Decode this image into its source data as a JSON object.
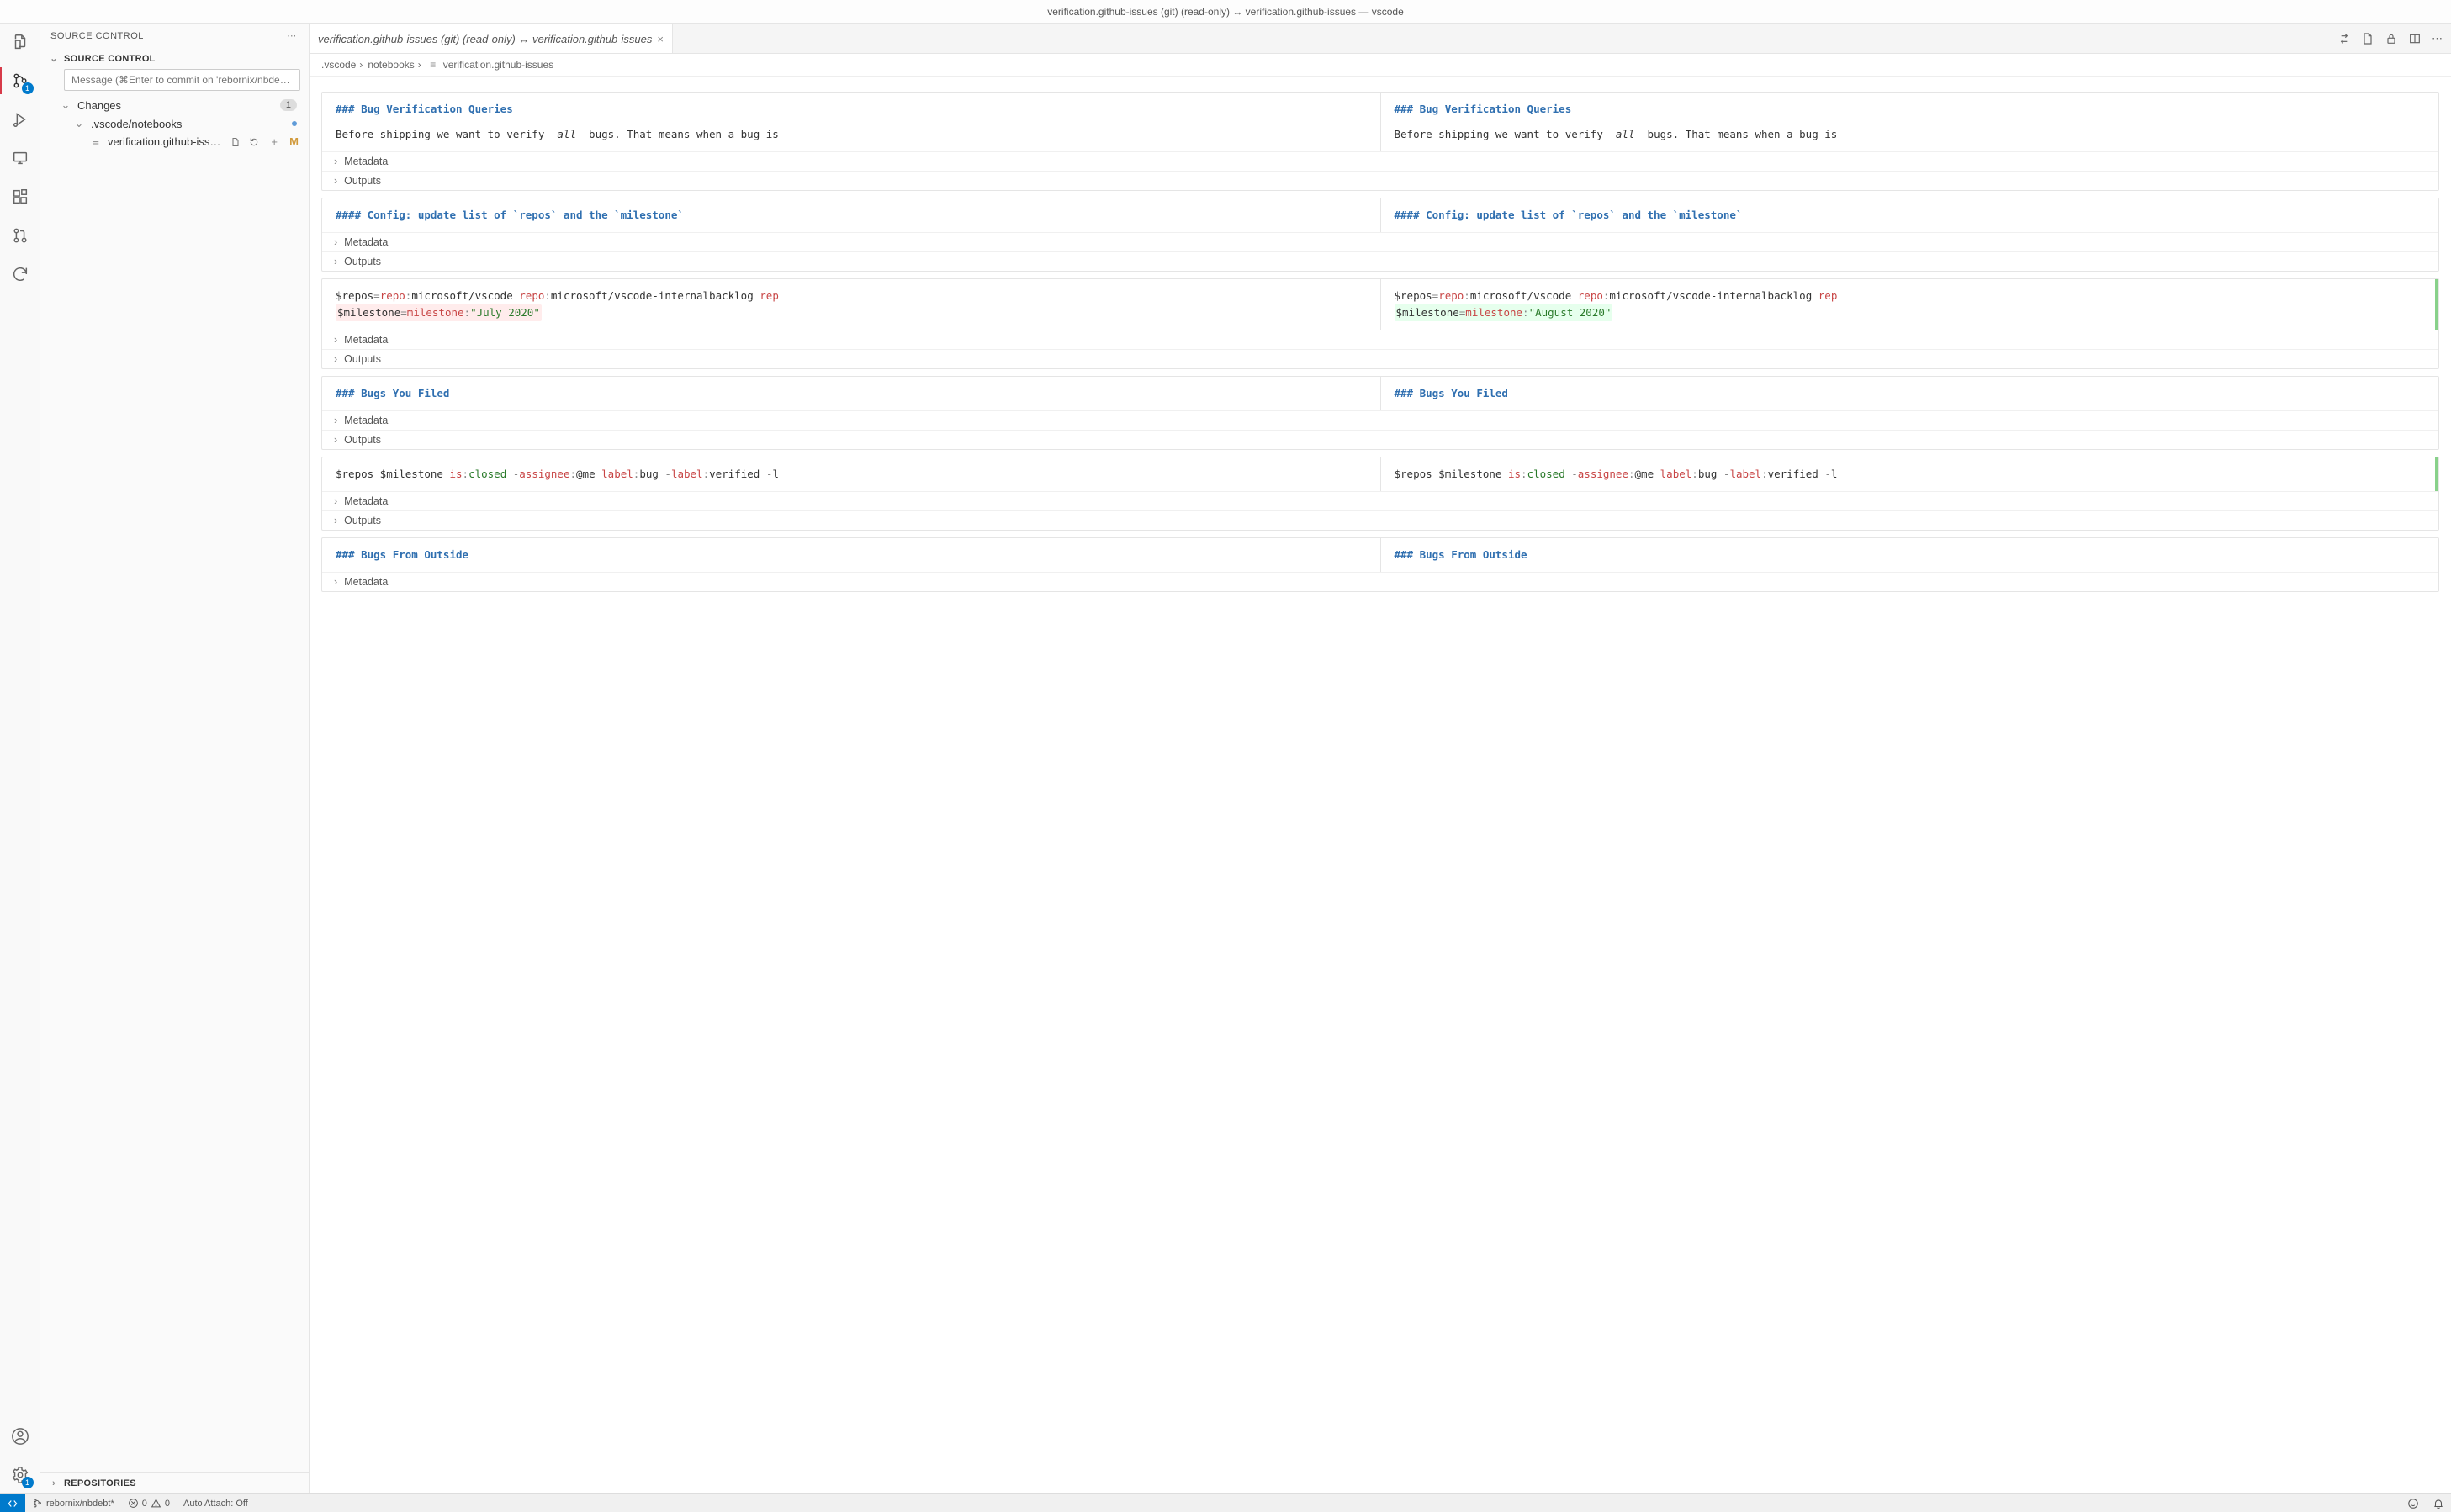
{
  "window": {
    "title": "verification.github-issues (git) (read-only) ↔ verification.github-issues — vscode"
  },
  "activitybar": {
    "scm_badge": "1",
    "settings_badge": "1"
  },
  "sidebar": {
    "title": "SOURCE CONTROL",
    "section": "SOURCE CONTROL",
    "message_placeholder": "Message (⌘Enter to commit on 'rebornix/nbde…",
    "changes_label": "Changes",
    "changes_count": "1",
    "folder": ".vscode/notebooks",
    "file": "verification.github-issues",
    "file_status": "M",
    "repositories": "REPOSITORIES"
  },
  "tab": {
    "label": "verification.github-issues (git) (read-only) ↔ verification.github-issues"
  },
  "breadcrumbs": {
    "a": ".vscode",
    "b": "notebooks",
    "c": "verification.github-issues"
  },
  "labels": {
    "metadata": "Metadata",
    "outputs": "Outputs"
  },
  "cells": {
    "c1": {
      "h": "### Bug Verification Queries",
      "p_pre": "Before shipping we want to verify ",
      "p_em": "_all_",
      "p_post": " bugs. That means when a bug is"
    },
    "c2": {
      "h": "#### Config: update list of `repos` and the `milestone`"
    },
    "c3": {
      "line1": {
        "var": "$repos",
        "eq": "=",
        "k1": "repo",
        "c1": ":",
        "v1": "microsoft/vscode ",
        "k2": "repo",
        "c2": ":",
        "v2": "microsoft/vscode-internalbacklog ",
        "k3": "rep"
      },
      "line2": {
        "var": "$milestone",
        "eq": "=",
        "k": "milestone",
        "c": ":",
        "old": "\"July 2020\"",
        "new": "\"August 2020\""
      }
    },
    "c4": {
      "h": "### Bugs You Filed"
    },
    "c5": {
      "pre": "$repos $milestone ",
      "k1": "is",
      "c1": ":",
      "v1": "closed ",
      "dash1": "-",
      "k2": "assignee",
      "c2": ":",
      "v2": "@me ",
      "k3": "label",
      "c3": ":",
      "v3": "bug ",
      "dash2": "-",
      "k4": "label",
      "c4": ":",
      "v4": "verified ",
      "dash3": "-",
      "tail": "l"
    },
    "c6": {
      "h": "### Bugs From Outside"
    }
  },
  "statusbar": {
    "branch": "rebornix/nbdebt*",
    "err": "0",
    "warn": "0",
    "attach": "Auto Attach: Off"
  },
  "chart_data": null
}
